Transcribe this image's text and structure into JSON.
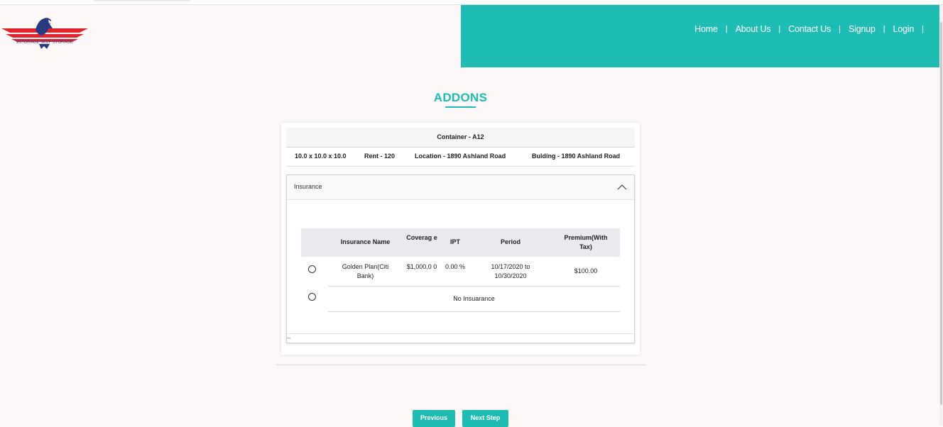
{
  "header": {
    "brand_text": "9STORAGE SELF STORAGE",
    "nav": [
      {
        "label": "Home"
      },
      {
        "label": "About Us"
      },
      {
        "label": "Contact Us"
      },
      {
        "label": "Signup"
      },
      {
        "label": "Login"
      }
    ],
    "separator": "|",
    "colors": {
      "accent": "#1ebcb2",
      "logo_red": "#e0232e",
      "logo_navy": "#2a3a7e"
    }
  },
  "page": {
    "title": "ADDONS"
  },
  "container": {
    "title": "Container - A12",
    "size": "10.0 x 10.0 x 10.0",
    "rent": "Rent - 120",
    "location": "Location - 1890 Ashland Road",
    "building": "Bulding - 1890 Ashland Road"
  },
  "insurance_panel": {
    "label": "Insurance",
    "chevron_icon": "chevron-up-icon",
    "columns": {
      "name": "Insurance Name",
      "coverage": "Coverag e",
      "ipt": "IPT",
      "period": "Period",
      "premium": "Premium(With Tax)"
    },
    "rows": [
      {
        "name": "Golden Plan(Citi Bank)",
        "coverage": "$1,000.0 0",
        "ipt": "0.00 %",
        "period": "10/17/2020 to 10/30/2020",
        "premium": "$100.00",
        "selected": false
      }
    ],
    "no_insurance_label": "No Insuarance",
    "footer_mark": "–"
  },
  "actions": {
    "previous": "Previous",
    "next": "Next Step"
  }
}
